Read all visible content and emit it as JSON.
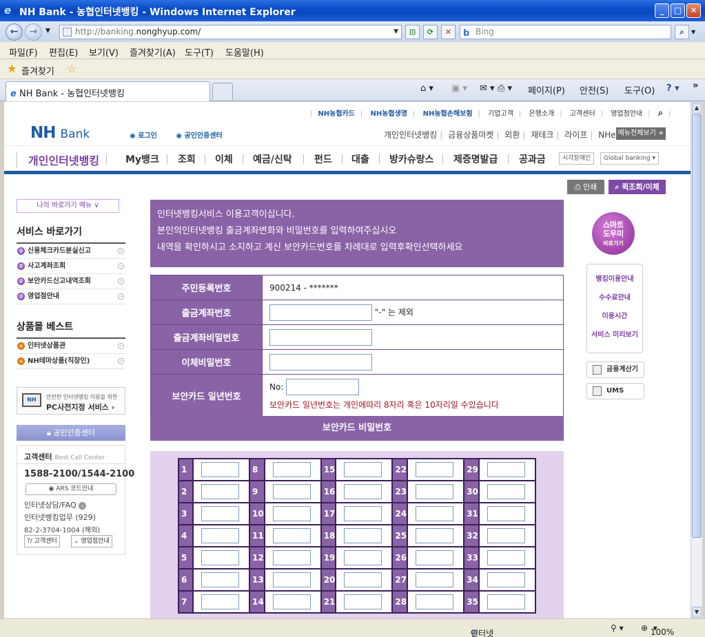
{
  "window": {
    "title": "NH Bank - 농협인터넷뱅킹 - Windows Internet Explorer"
  },
  "browser": {
    "url_prefix": "http://banking.",
    "url_domain": "nonghyup.com/",
    "search_placeholder": "Bing",
    "menu": [
      "파일(F)",
      "편집(E)",
      "보기(V)",
      "즐겨찾기(A)",
      "도구(T)",
      "도움말(H)"
    ],
    "favorites_label": "즐겨찾기",
    "tab_title": "NH Bank - 농협인터넷뱅킹",
    "cmd": {
      "page": "페이지(P)",
      "safety": "안전(S)",
      "tools": "도구(O)"
    },
    "status": {
      "zone": "인터넷",
      "zoom": "100%"
    }
  },
  "site": {
    "util_nav": [
      "NH농협카드",
      "NH농협생명",
      "NH농협손해보험",
      "기업고객",
      "은행소개",
      "고객센터",
      "영업점안내"
    ],
    "logo_nh": "NH",
    "logo_bank": "Bank",
    "login": "로그인",
    "cert_center": "공인인증센터",
    "gnb2": [
      "개인인터넷뱅킹",
      "금융상품마켓",
      "외환",
      "재테크",
      "라이프",
      "NHe금융"
    ],
    "all_menu": "메뉴전체보기 +",
    "brand": "개인인터넷뱅킹",
    "main_nav": [
      "My뱅크",
      "조회",
      "이체",
      "예금/신탁",
      "펀드",
      "대출",
      "방카슈랑스",
      "제증명발급",
      "공과금"
    ],
    "accessibility": "시각장애인",
    "global": "Global banking ▾",
    "print": "인쇄",
    "quick": "퀵조회/이체"
  },
  "sidebar": {
    "my_menu": "나의 바로가기 메뉴 ∨",
    "service_title": "서비스 바로가기",
    "service_items": [
      "신용체크카드분실신고",
      "사고계좌조회",
      "보안카드신고내역조회",
      "영업점안내"
    ],
    "best_title": "상품몰 베스트",
    "best_items": [
      "인터넷상품관",
      "NH테마상품(직장인)"
    ],
    "pc_banner_line1": "안전한 인터넷뱅킹 이용을 위한",
    "pc_banner_line2": "PC사전지정 서비스 ›",
    "cert_button": "공인인증센터",
    "call_title": "고객센터",
    "call_sub": "Best Call Center",
    "call_number": "1588-2100/1544-2100",
    "ars": "ARS 코드안내",
    "consult": "인터넷상담/FAQ",
    "biz": "인터넷뱅킹업무 (929)",
    "overseas": "82-2-3704-1004 (해외)",
    "btn_center": "?/ 고객센터",
    "btn_branch": "영업점안내"
  },
  "notice": {
    "line1": "인터넷뱅킹서비스 이용고객이십니다.",
    "line2": "본인의인터넷뱅킹 출금계좌변화와 비밀번호를 입력하여주십시오",
    "line3": "내역을 확인하시고 소지하고 계신 보안카드번호를 차례대로 입력후확인선택하세요"
  },
  "form": {
    "resident_label": "주민등록번호",
    "resident_value": "900214 - *******",
    "account_label": "출금계좌번호",
    "account_hint": "\"-\" 는 제외",
    "account_pw_label": "출금계좌비밀번호",
    "transfer_pw_label": "이체비밀번호",
    "card_serial_label": "보안카드 일년번호",
    "card_no_prefix": "No:",
    "card_note": "보안카드 일년번호는 개인에따리 8자리 혹은 10자리일 수있습니다",
    "card_pw_header": "보안카드 비밀번호"
  },
  "code_grid": {
    "rows": [
      [
        1,
        8,
        15,
        22,
        29
      ],
      [
        2,
        9,
        16,
        23,
        30
      ],
      [
        3,
        10,
        17,
        24,
        31
      ],
      [
        4,
        11,
        18,
        25,
        32
      ],
      [
        5,
        12,
        19,
        26,
        33
      ],
      [
        6,
        13,
        20,
        27,
        34
      ],
      [
        7,
        14,
        21,
        28,
        35
      ]
    ]
  },
  "helper": {
    "tag1": "스마트",
    "tag2": "도우미",
    "tag3": "바로가기",
    "items": [
      "뱅킹이용안내",
      "수수료안내",
      "이용시간",
      "서비스 미리보기"
    ],
    "calc": "금융계산기",
    "ums": "UMS"
  },
  "colors": {
    "purple": "#8a62a6",
    "blue": "#1a5b9c",
    "brand": "#7a3fa6"
  }
}
